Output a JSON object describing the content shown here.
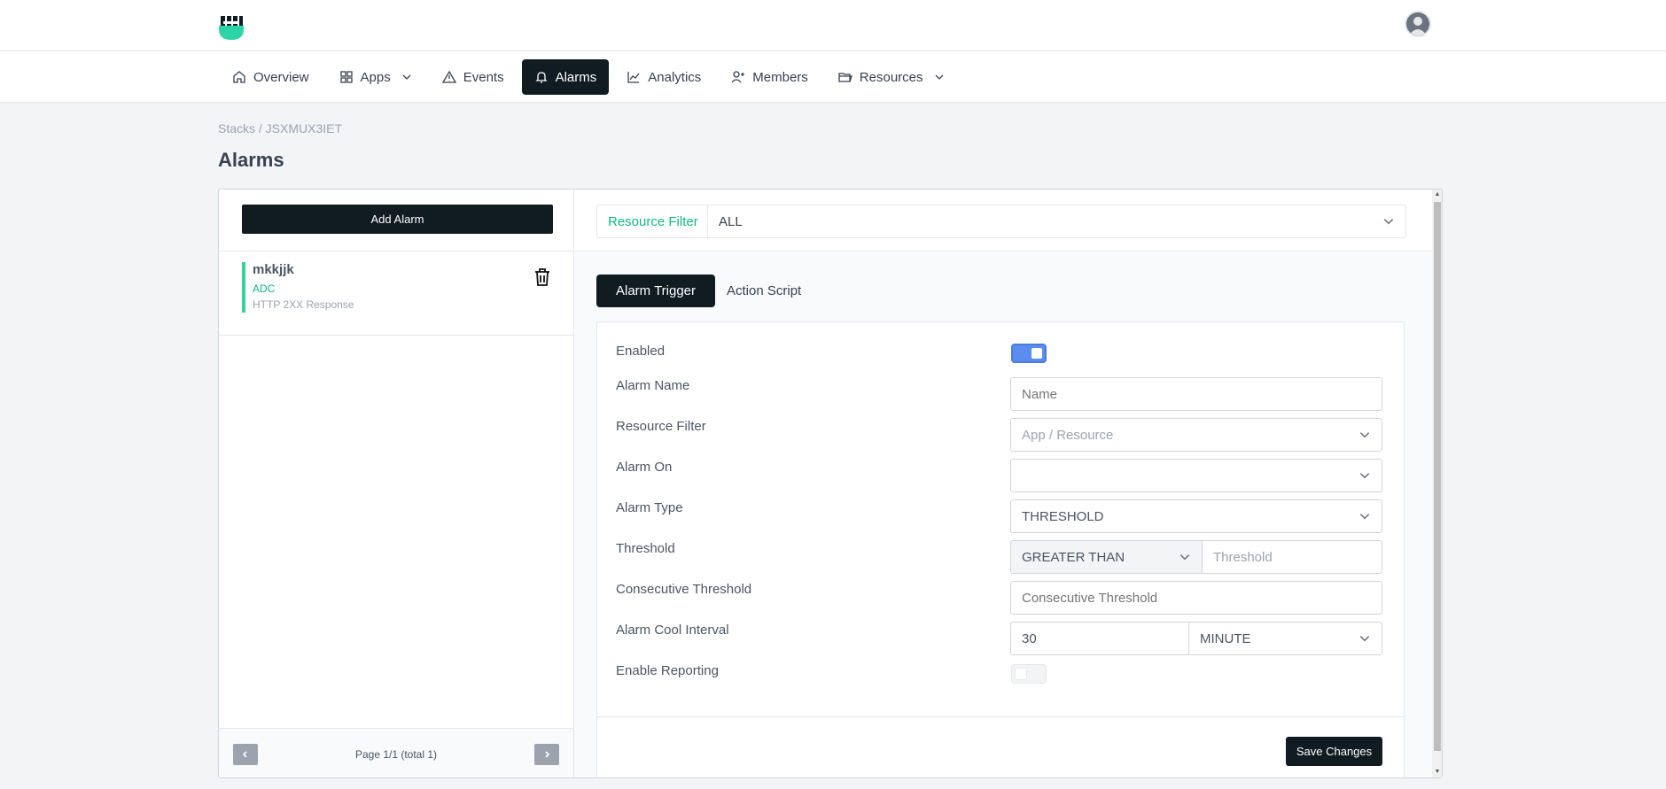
{
  "nav": {
    "items": [
      {
        "label": "Overview",
        "icon": "home-icon"
      },
      {
        "label": "Apps",
        "icon": "grid-icon",
        "dropdown": true
      },
      {
        "label": "Events",
        "icon": "warning-icon"
      },
      {
        "label": "Alarms",
        "icon": "bell-icon",
        "active": true
      },
      {
        "label": "Analytics",
        "icon": "chart-icon"
      },
      {
        "label": "Members",
        "icon": "users-icon"
      },
      {
        "label": "Resources",
        "icon": "folder-icon",
        "dropdown": true
      }
    ]
  },
  "breadcrumb": "Stacks / JSXMUX3IET",
  "page_title": "Alarms",
  "sidebar": {
    "add_label": "Add Alarm",
    "alarm": {
      "name": "mkkjjk",
      "app": "ADC",
      "metric": "HTTP 2XX Response"
    },
    "pager_text": "Page 1/1 (total 1)"
  },
  "filter": {
    "label": "Resource Filter",
    "value": "ALL"
  },
  "tabs": {
    "trigger": "Alarm Trigger",
    "script": "Action Script"
  },
  "form": {
    "enabled_label": "Enabled",
    "name_label": "Alarm Name",
    "name_placeholder": "Name",
    "resource_label": "Resource Filter",
    "resource_placeholder": "App / Resource",
    "alarm_on_label": "Alarm On",
    "alarm_on_value": "",
    "type_label": "Alarm Type",
    "type_value": "THRESHOLD",
    "threshold_label": "Threshold",
    "threshold_op": "GREATER THAN",
    "threshold_placeholder": "Threshold",
    "consecutive_label": "Consecutive Threshold",
    "consecutive_placeholder": "Consecutive Threshold",
    "cool_label": "Alarm Cool Interval",
    "cool_value": "30",
    "cool_unit": "MINUTE",
    "reporting_label": "Enable Reporting",
    "save_label": "Save Changes"
  },
  "colors": {
    "accent": "#10b981",
    "dark": "#111b22",
    "toggle": "#5b8def"
  }
}
